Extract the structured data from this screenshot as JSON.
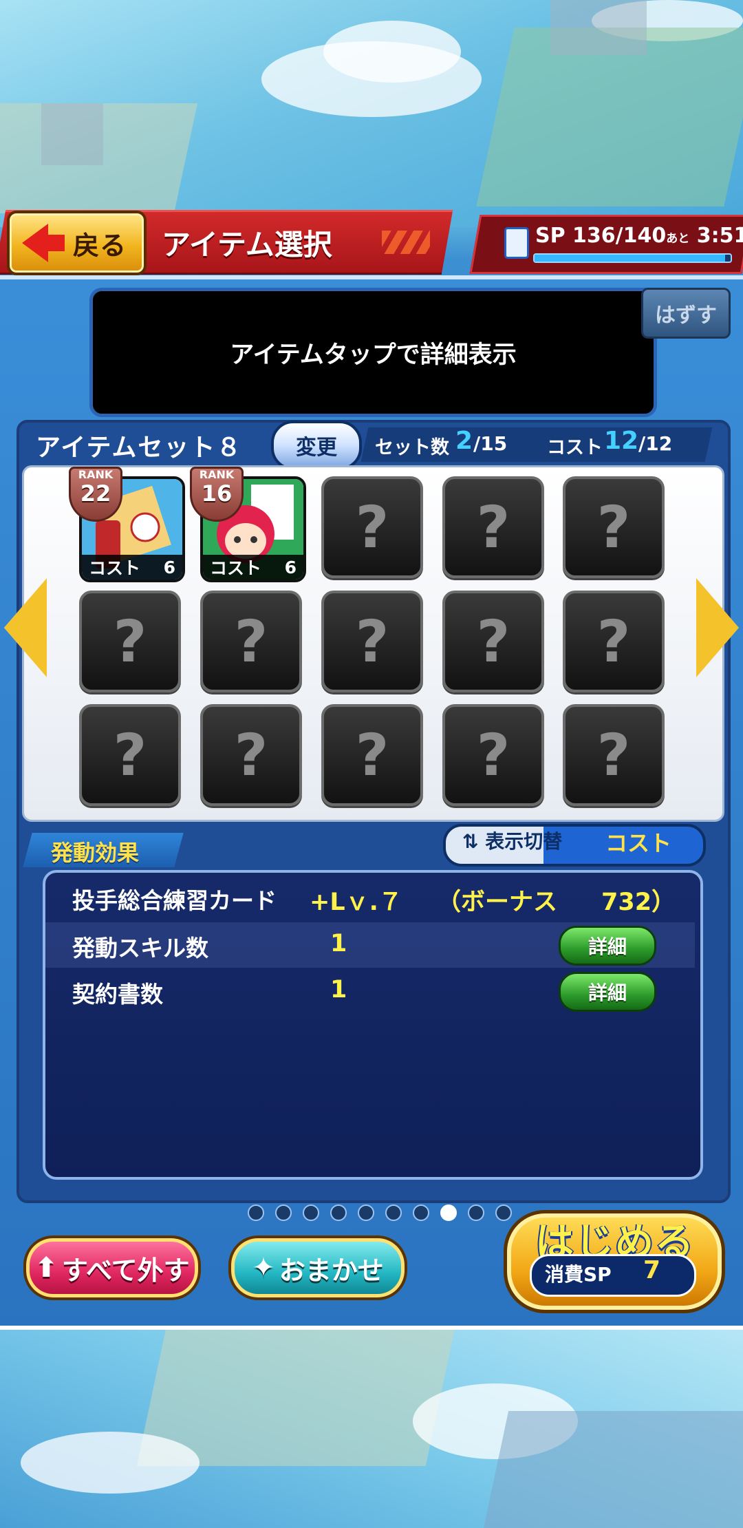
{
  "header": {
    "back_label": "戻る",
    "title": "アイテム選択",
    "sp_label": "SP",
    "sp_current": "136",
    "sp_max": "140",
    "sp_remaining_label": "あと",
    "sp_timer": "3:51",
    "sp_fill_fraction": 0.971
  },
  "info": {
    "message": "アイテムタップで詳細表示",
    "remove_label": "はずす"
  },
  "set": {
    "name": "アイテムセット８",
    "change_label": "変更",
    "count_label": "セット数",
    "count_value": "2",
    "count_max": "15",
    "cost_label": "コスト",
    "cost_value": "12",
    "cost_max": "12"
  },
  "items": [
    {
      "rank_label": "RANK",
      "rank": "22",
      "cost_label": "コスト",
      "cost": "6"
    },
    {
      "rank_label": "RANK",
      "rank": "16",
      "cost_label": "コスト",
      "cost": "6"
    }
  ],
  "empty_slot_symbol": "?",
  "effects": {
    "section_label": "発動効果",
    "toggle_label": "表示切替",
    "toggle_value": "コスト",
    "rows": [
      {
        "name": "投手総合練習カード",
        "value": "+Lｖ.７",
        "extra": "（ボーナス",
        "extra_value": "732）"
      },
      {
        "name": "発動スキル数",
        "value": "1",
        "detail": "詳細"
      },
      {
        "name": "契約書数",
        "value": "1",
        "detail": "詳細"
      }
    ]
  },
  "pagination": {
    "total": 10,
    "active_index": 7
  },
  "bottom": {
    "remove_all_label": "すべて外す",
    "auto_label": "おまかせ",
    "start_label": "はじめる",
    "sp_cost_label": "消費SP",
    "sp_cost_value": "7"
  },
  "icons": {
    "back": "left-arrow-icon",
    "sp": "sp-card-icon",
    "nav_left": "chevron-left-icon",
    "nav_right": "chevron-right-icon",
    "remove_all": "up-arrow-icon",
    "auto": "sparkle-icon"
  }
}
